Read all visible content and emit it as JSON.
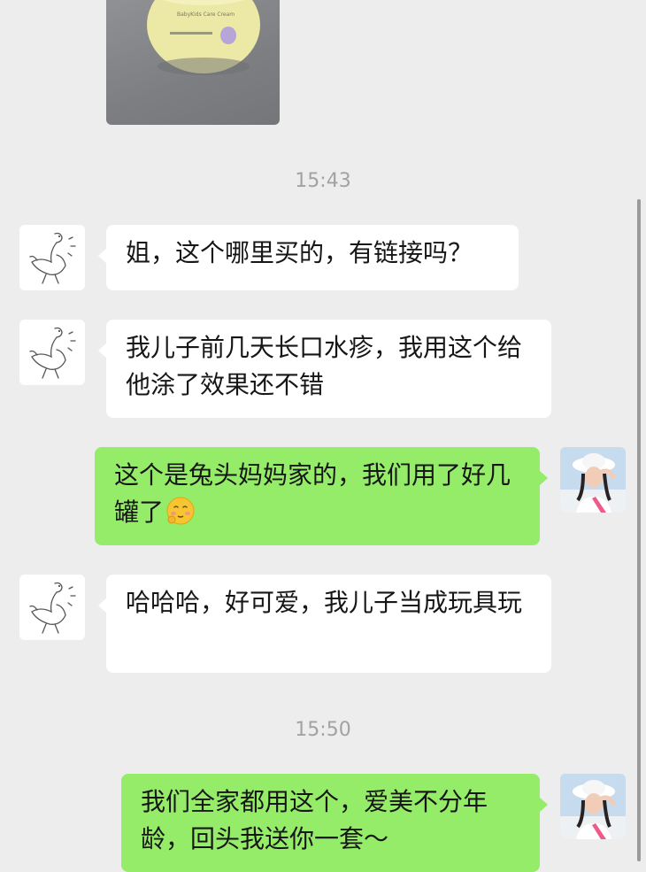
{
  "chat": {
    "messages": [
      {
        "id": "m1",
        "type": "image",
        "side": "left",
        "product_text": "BabyKids Care Cream"
      },
      {
        "id": "t1",
        "type": "time",
        "text": "15:43"
      },
      {
        "id": "m2",
        "type": "text",
        "side": "left",
        "text": "姐，这个哪里买的，有链接吗？"
      },
      {
        "id": "m3",
        "type": "text",
        "side": "left",
        "text": "我儿子前几天长口水疹，我用这个给他涂了效果还不错"
      },
      {
        "id": "m4",
        "type": "text",
        "side": "right",
        "text": "这个是兔头妈妈家的，我们用了好几罐了",
        "emoji": "shy-face-emoji"
      },
      {
        "id": "m5",
        "type": "text",
        "side": "left",
        "text": "哈哈哈，好可爱，我儿子当成玩具玩"
      },
      {
        "id": "t2",
        "type": "time",
        "text": "15:50"
      },
      {
        "id": "m6",
        "type": "text",
        "side": "right",
        "text": "我们全家都用这个，爱美不分年龄，回头我送你一套～"
      }
    ]
  },
  "colors": {
    "background": "#ededed",
    "incoming_bubble": "#ffffff",
    "outgoing_bubble": "#95ec69",
    "time_text": "#a2a2a2"
  }
}
